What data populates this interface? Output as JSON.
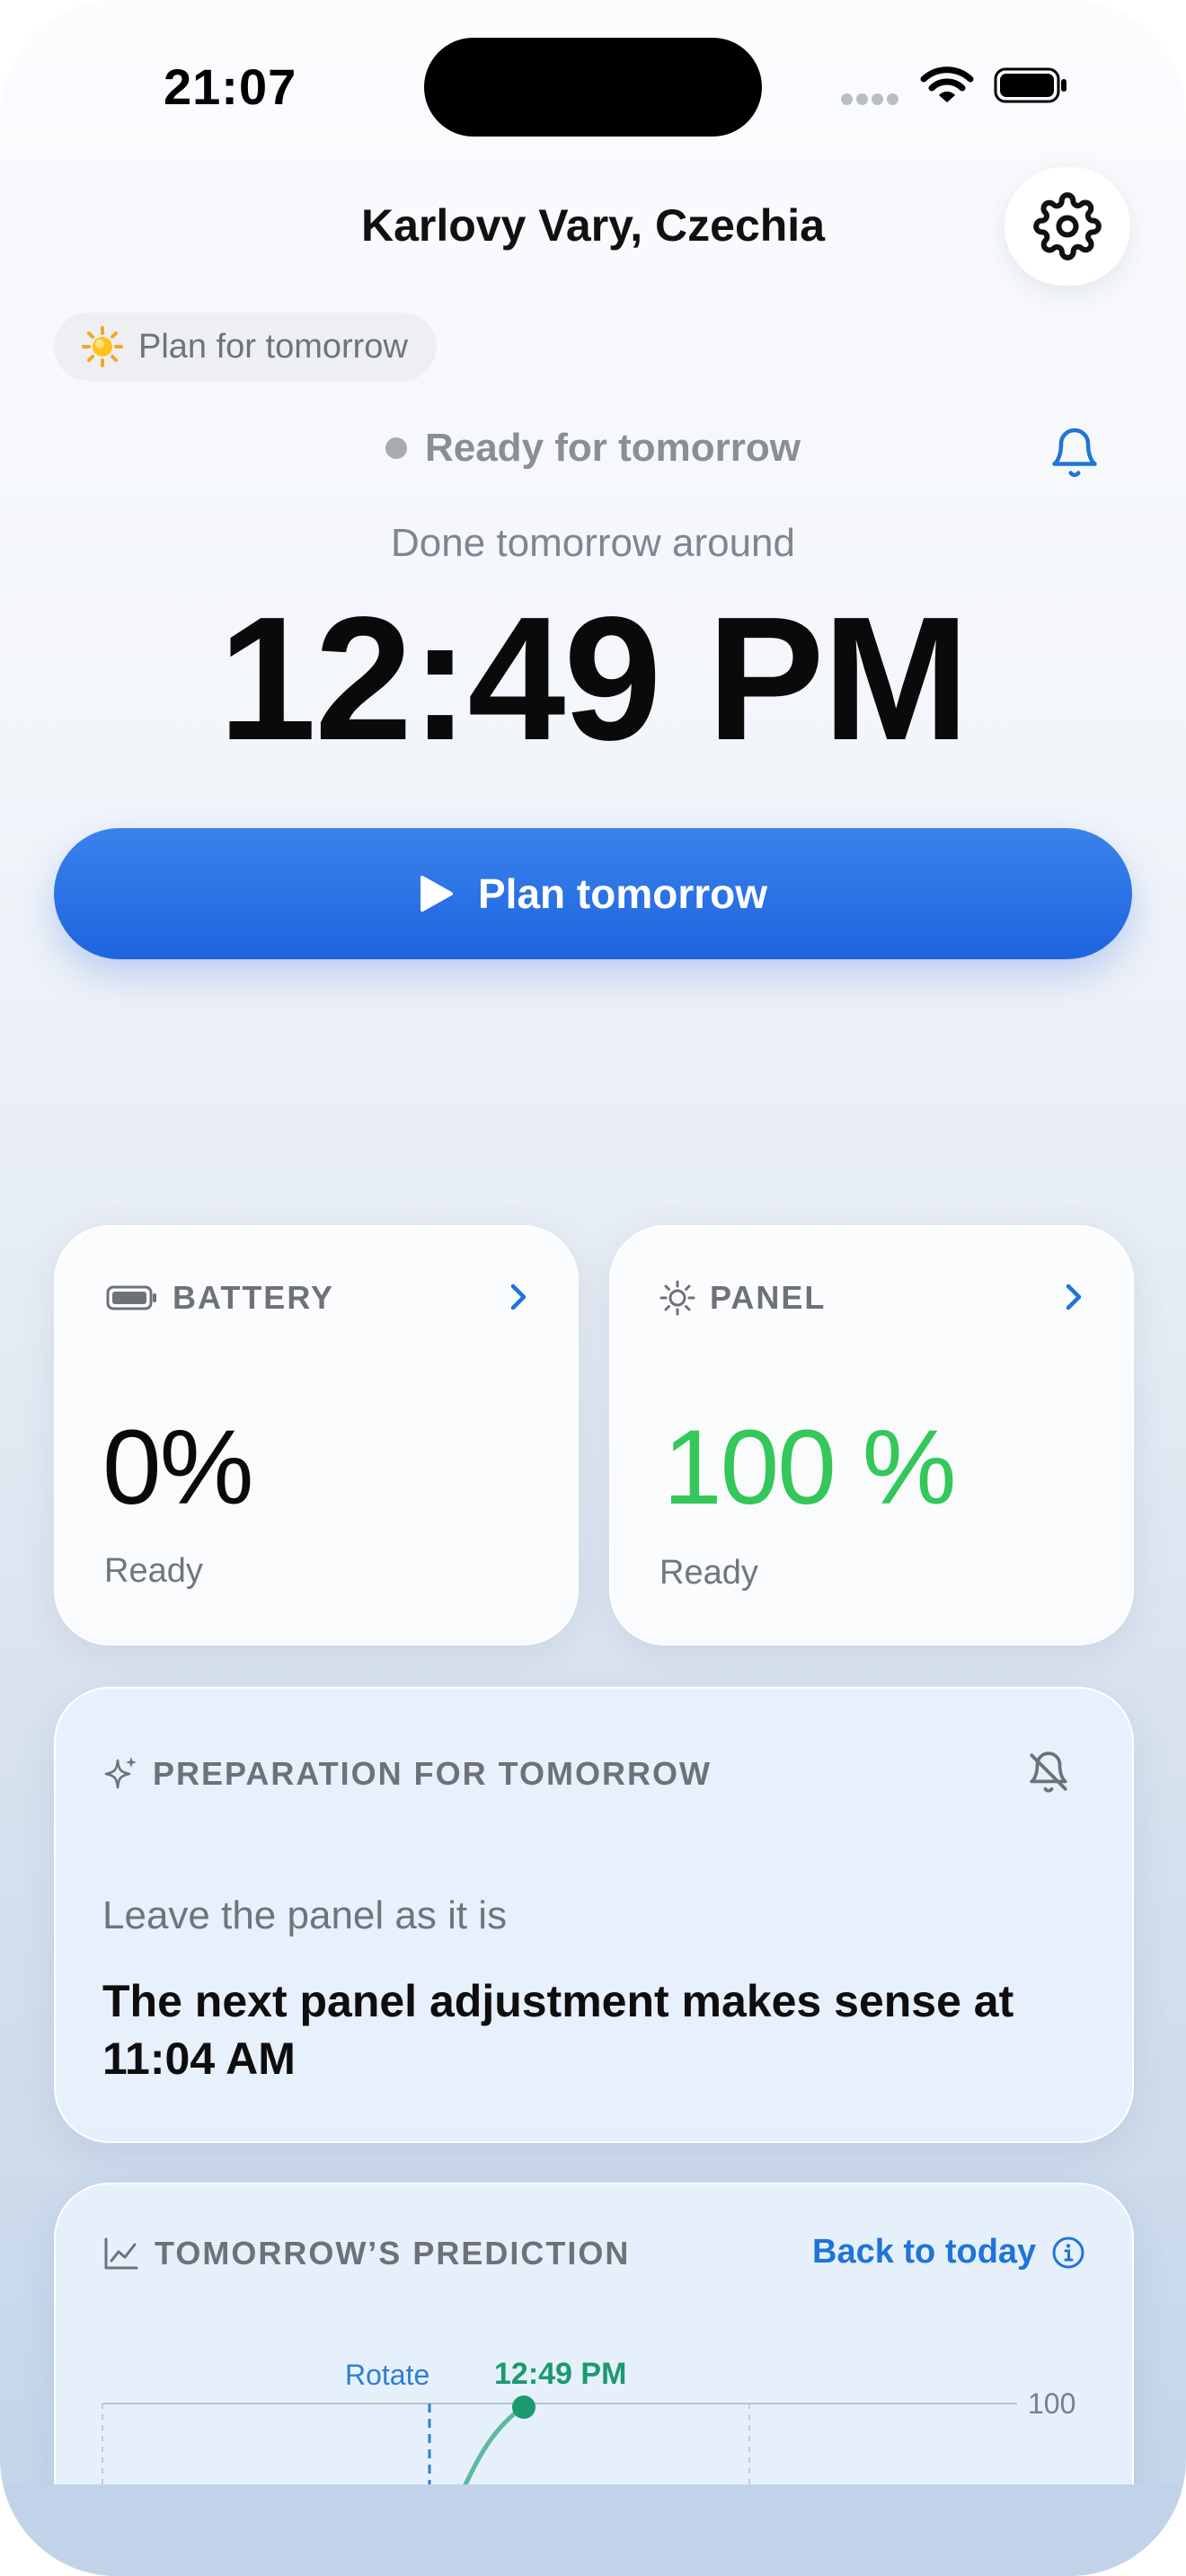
{
  "status_bar": {
    "time": "21:07"
  },
  "header": {
    "location": "Karlovy Vary, Czechia"
  },
  "mode_chip": {
    "label": "Plan for tomorrow",
    "icon": "sun-icon"
  },
  "status": {
    "text": "Ready for tomorrow",
    "dot_color": "#a7abb1"
  },
  "done": {
    "label": "Done tomorrow around",
    "time": "12:49 PM"
  },
  "cta": {
    "label": "Plan tomorrow",
    "color": "#2a72e6"
  },
  "battery_card": {
    "title": "BATTERY",
    "value": "0%",
    "status": "Ready"
  },
  "panel_card": {
    "title": "PANEL",
    "value": "100 %",
    "status": "Ready",
    "value_color": "#34c759"
  },
  "prep_card": {
    "title": "PREPARATION FOR TOMORROW",
    "subtitle": "Leave the panel as it is",
    "message": "The next panel adjustment makes sense at 11:04 AM"
  },
  "prediction_card": {
    "title": "TOMORROW’S PREDICTION",
    "back_link": "Back to today",
    "chart": {
      "rotate_label": "Rotate",
      "peak_time_label": "12:49 PM",
      "y_max_label": "100"
    }
  },
  "colors": {
    "accent": "#1f74d8",
    "green": "#34c759",
    "teal": "#1a9a6e"
  }
}
